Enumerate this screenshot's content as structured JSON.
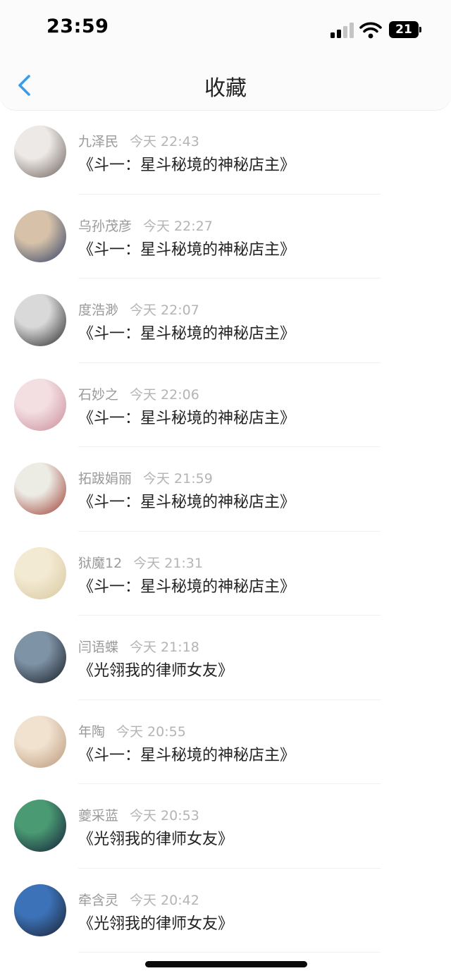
{
  "status_bar": {
    "time": "23:59",
    "battery": "21"
  },
  "nav": {
    "title": "收藏",
    "back_icon": "chevron-left-icon"
  },
  "colors": {
    "accent": "#3a9be8",
    "meta_text": "#9a9a9a",
    "title_text": "#222222"
  },
  "items": [
    {
      "user": "九泽民",
      "time": "今天 22:43",
      "book": "《斗一：星斗秘境的神秘店主》",
      "avatar": [
        "#ede9e6",
        "#6a5e58"
      ]
    },
    {
      "user": "乌孙茂彦",
      "time": "今天 22:27",
      "book": "《斗一：星斗秘境的神秘店主》",
      "avatar": [
        "#d7c2a9",
        "#2f3f66"
      ]
    },
    {
      "user": "度浩渺",
      "time": "今天 22:07",
      "book": "《斗一：星斗秘境的神秘店主》",
      "avatar": [
        "#d9d9d9",
        "#262626"
      ]
    },
    {
      "user": "石妙之",
      "time": "今天 22:06",
      "book": "《斗一：星斗秘境的神秘店主》",
      "avatar": [
        "#f3dfe2",
        "#c98a98"
      ]
    },
    {
      "user": "拓跋娟丽",
      "time": "今天 21:59",
      "book": "《斗一：星斗秘境的神秘店主》",
      "avatar": [
        "#ecebe4",
        "#9b3a2f"
      ]
    },
    {
      "user": "狱魔12",
      "time": "今天 21:31",
      "book": "《斗一：星斗秘境的神秘店主》",
      "avatar": [
        "#f3ead3",
        "#d8c79d"
      ]
    },
    {
      "user": "闫语蝶",
      "time": "今天 21:18",
      "book": "《光翎我的律师女友》",
      "avatar": [
        "#7f93a6",
        "#141a22"
      ]
    },
    {
      "user": "年陶",
      "time": "今天 20:55",
      "book": "《斗一：星斗秘境的神秘店主》",
      "avatar": [
        "#f1e1cf",
        "#b99678"
      ]
    },
    {
      "user": "夔采蓝",
      "time": "今天 20:53",
      "book": "《光翎我的律师女友》",
      "avatar": [
        "#4a9a74",
        "#121c34"
      ]
    },
    {
      "user": "牵含灵",
      "time": "今天 20:42",
      "book": "《光翎我的律师女友》",
      "avatar": [
        "#3c73b8",
        "#1a1f2e"
      ]
    }
  ]
}
